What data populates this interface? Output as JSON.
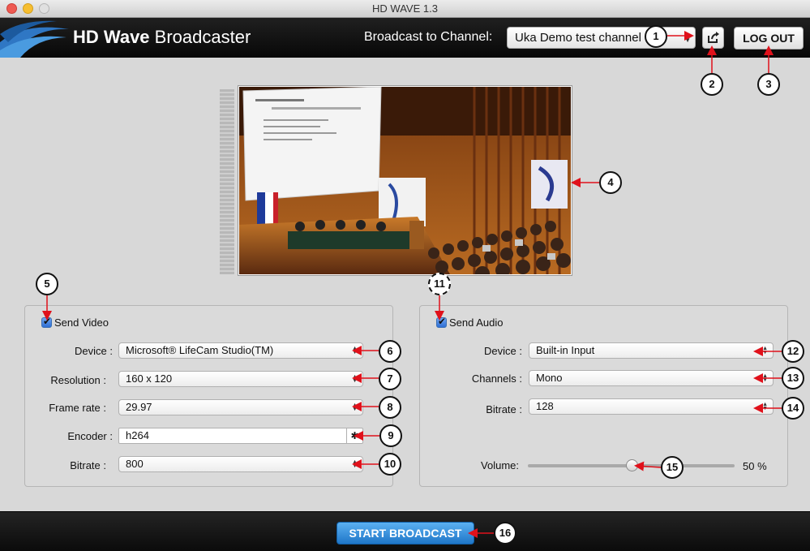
{
  "window": {
    "title": "HD WAVE 1.3"
  },
  "header": {
    "brand_bold": "HD Wave",
    "brand_light": "Broadcaster",
    "channel_label": "Broadcast to Channel:",
    "channel_value": "Uka Demo test channel",
    "logout_label": "LOG OUT"
  },
  "video": {
    "send_label": "Send Video",
    "device_label": "Device :",
    "device_value": "Microsoft® LifeCam Studio(TM)",
    "resolution_label": "Resolution :",
    "resolution_value": "160 x 120",
    "framerate_label": "Frame rate :",
    "framerate_value": "29.97",
    "encoder_label": "Encoder :",
    "encoder_value": "h264",
    "bitrate_label": "Bitrate :",
    "bitrate_value": "800"
  },
  "audio": {
    "send_label": "Send Audio",
    "device_label": "Device :",
    "device_value": "Built-in Input",
    "channels_label": "Channels :",
    "channels_value": "Mono",
    "bitrate_label": "Bitrate :",
    "bitrate_value": "128",
    "volume_label": "Volume:",
    "volume_percent": 50,
    "volume_value": "50 %"
  },
  "footer": {
    "start_label": "START BROADCAST"
  },
  "callouts": [
    "1",
    "2",
    "3",
    "4",
    "5",
    "6",
    "7",
    "8",
    "9",
    "10",
    "11",
    "12",
    "13",
    "14",
    "15",
    "16"
  ],
  "colors": {
    "accent_arrow": "#e0111b",
    "start_button": "#2b86d8"
  }
}
